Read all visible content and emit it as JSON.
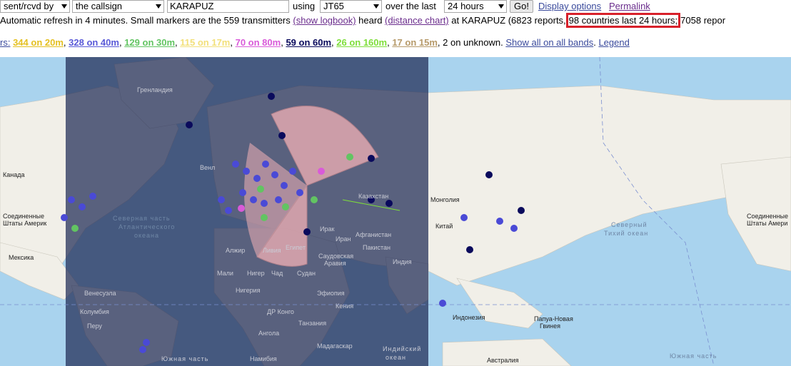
{
  "controls": {
    "mode_select": "sent/rcvd by",
    "target_select": "the callsign",
    "callsign_value": "KARAPUZ",
    "using_label": "using",
    "mode_value": "JT65",
    "over_label": "over the last",
    "period_value": "24 hours",
    "go_button": "Go!",
    "display_options_link": "Display options",
    "permalink_link": "Permalink"
  },
  "status": {
    "prefix": "Automatic refresh in 4 minutes. Small markers are the 559 transmitters",
    "logbook_link": "(show logbook)",
    "heard": "heard",
    "distance_link": "(distance chart)",
    "at_text": "at KARAPUZ (6823 reports,",
    "countries_highlight": "98 countries last 24 hours;",
    "suffix": "7058 repor"
  },
  "bands": {
    "prefix": "rs:",
    "items": [
      {
        "label": "344 on 20m",
        "color": "#e4c020"
      },
      {
        "label": "328 on 40m",
        "color": "#5a5ad8"
      },
      {
        "label": "129 on 30m",
        "color": "#62c462"
      },
      {
        "label": "115 on 17m",
        "color": "#f2e07a"
      },
      {
        "label": "70 on 80m",
        "color": "#d95ad9"
      },
      {
        "label": "59 on 60m",
        "color": "#0a0a5c"
      },
      {
        "label": "26 on 160m",
        "color": "#7ede3a"
      },
      {
        "label": "17 on 15m",
        "color": "#b69a6a"
      }
    ],
    "unknown_text": ", 2 on unknown.",
    "show_all_link": "Show all on all bands",
    "legend_link": "Legend"
  },
  "map": {
    "labels": [
      "Гренландия",
      "Канада",
      "Соединенные",
      "Штаты Америк",
      "Мексика",
      "Венесуэла",
      "Северная часть",
      "Атлантического",
      "океана",
      "Алжир",
      "Ливия",
      "Египет",
      "Мали",
      "Нигер",
      "Чад",
      "Судан",
      "Эфиопия",
      "Нигерия",
      "ДР Конго",
      "Танзания",
      "Ангола",
      "Намибия",
      "Мадагаскар",
      "Казахстан",
      "Монголия",
      "Китай",
      "Индия",
      "Афганистан",
      "Пакистан",
      "Саудовская",
      "Аравия",
      "Ирак",
      "Иран",
      "Венл",
      "Южная часть",
      "Индийский",
      "океан",
      "Индонезия",
      "Папуа-Новая",
      "Гвинея",
      "Австралия",
      "Северный",
      "Тихий океан",
      "Соединенные",
      "Штаты Амери",
      "Южная часть",
      "Кения",
      "Колумбия",
      "Перу"
    ]
  }
}
